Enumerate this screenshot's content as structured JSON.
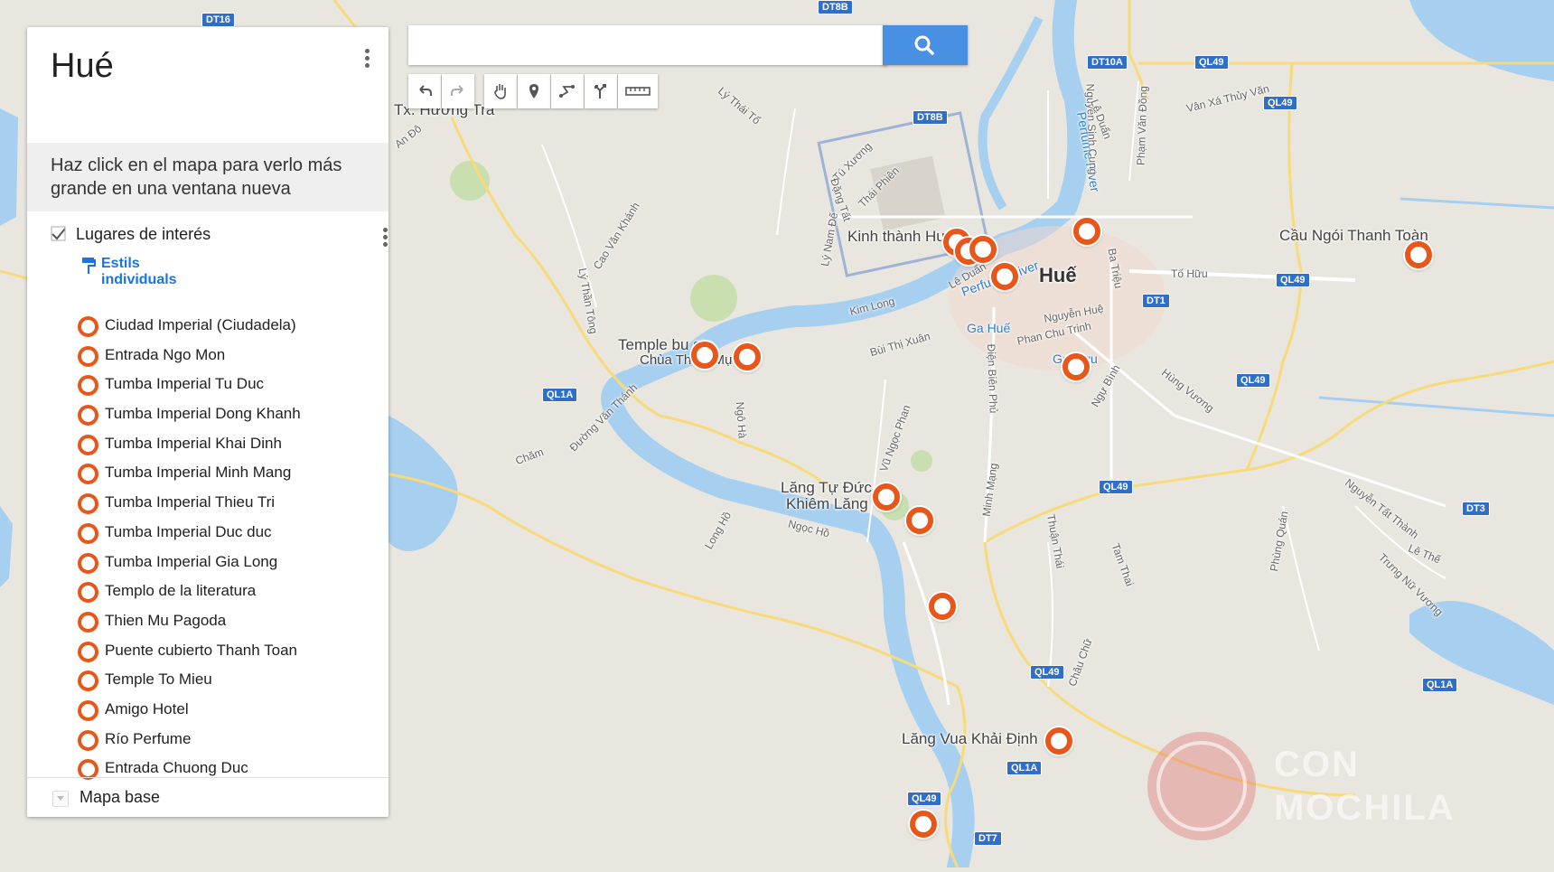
{
  "panel": {
    "title": "Hué",
    "description": "Haz click en el mapa para verlo más grande en una ventana nueva",
    "layer_name": "Lugares de interés",
    "layer_checked": true,
    "style_label": "Estils individuals",
    "basemap_label": "Mapa base",
    "places": [
      "Ciudad Imperial (Ciudadela)",
      "Entrada Ngo Mon",
      "Tumba Imperial Tu Duc",
      "Tumba Imperial Dong Khanh",
      "Tumba Imperial Khai Dinh",
      "Tumba Imperial Minh Mang",
      "Tumba Imperial Thieu Tri",
      "Tumba Imperial Duc duc",
      "Tumba Imperial Gia Long",
      "Templo de la literatura",
      "Thien Mu Pagoda",
      "Puente cubierto Thanh Toan",
      "Temple To Mieu",
      "Amigo Hotel",
      "Río Perfume",
      "Entrada Chuong Duc"
    ]
  },
  "search": {
    "placeholder": "",
    "button_icon": "search-icon"
  },
  "toolbar": [
    "undo-icon",
    "redo-icon",
    "pan-hand-icon",
    "add-marker-icon",
    "draw-line-icon",
    "directions-icon",
    "ruler-icon"
  ],
  "map": {
    "place_labels": {
      "city": "Huế",
      "citadel": "Kinh thành Huế",
      "bridge": "Cầu Ngói Thanh Toàn",
      "temple1": "Temple bu   sta",
      "temple2": "Chùa Thiên Mụ",
      "tomb1": "Lăng Tự Đức",
      "tomb2": "Khiêm Lăng",
      "tomb3": "Lăng Vua Khải Định",
      "station1": "Ga Huế",
      "station2": "Ga   Cựu",
      "town": "Tx. Hương Trà",
      "river": "Perfume River",
      "river2": "Perfume River"
    },
    "street_labels": {
      "s1": "Kim Long",
      "s2": "Lê Duẩn",
      "s3": "Nguyễn Huệ",
      "s4": "Phan Chu Trinh",
      "s5": "Tố Hữu",
      "s6": "Hùng Vương",
      "s7": "Ngự Bình",
      "s8": "Điện Biên Phủ",
      "s9": "Minh Mạng",
      "s10": "Bùi Thị Xuân",
      "s11": "Lý Thái Tổ",
      "s12": "Đường Văn Thánh",
      "s13": "Ngọc Hồ",
      "s14": "Long Hồ",
      "s15": "Vũ Ngọc Phan",
      "s16": "Nguyễn Tất Thành",
      "s17": "Phạm Văn Đồng",
      "s18": "Nguyễn Sinh Cung",
      "s19": "Lê Duẩn",
      "s20": "Chăm",
      "s21": "Lý Thần Tông",
      "s22": "Cao Văn Khánh",
      "s23": "Ba Triệu",
      "s24": "Thuận Thái",
      "s25": "Tam Thai",
      "s26": "Phùng Quán",
      "s27": "Châu Chữ",
      "s28": "Ngô Hà",
      "s29": "Trưng Nữ Vương",
      "s30": "Lê Thế",
      "s31": "An Đô",
      "s32": "Lý Nam Đế",
      "s33": "Vân Xá Thủy Văn",
      "s34": "Tú Xương",
      "s35": "Thái Phiên",
      "s36": "Đặng Tất"
    },
    "shields": {
      "h1": "DT16",
      "h2": "DT8B",
      "h3": "DT10A",
      "h4": "QL49",
      "h5": "QL49",
      "h6": "DT8B",
      "h7": "QL49",
      "h8": "DT1",
      "h9": "QL49",
      "h10": "QL1A",
      "h11": "QL49",
      "h12": "DT3",
      "h13": "QL49",
      "h14": "QL1A",
      "h15": "QL49",
      "h16": "DT7",
      "h17": "QL1A"
    },
    "watermark": "CON MOCHILA",
    "marker_color": "#e8561a",
    "marker_count": 18
  }
}
